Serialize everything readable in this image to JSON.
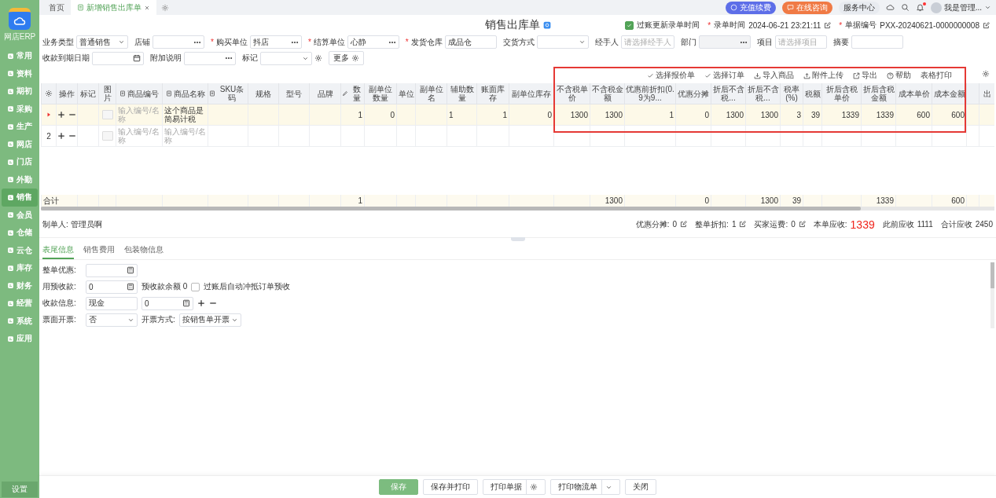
{
  "sidebar": {
    "logo_caption": "网店ERP",
    "items": [
      {
        "label": "常用",
        "selected": false
      },
      {
        "label": "资料",
        "selected": false
      },
      {
        "label": "期初",
        "selected": false
      },
      {
        "label": "采购",
        "selected": false
      },
      {
        "label": "生产",
        "selected": false
      },
      {
        "label": "网店",
        "selected": false
      },
      {
        "label": "门店",
        "selected": false
      },
      {
        "label": "外勤",
        "selected": false
      },
      {
        "label": "销售",
        "selected": true
      },
      {
        "label": "会员",
        "selected": false
      },
      {
        "label": "仓储",
        "selected": false
      },
      {
        "label": "云仓",
        "selected": false
      },
      {
        "label": "库存",
        "selected": false
      },
      {
        "label": "财务",
        "selected": false
      },
      {
        "label": "经营",
        "selected": false
      },
      {
        "label": "系统",
        "selected": false
      },
      {
        "label": "应用",
        "selected": false
      }
    ],
    "settings": "设置"
  },
  "tabs": [
    {
      "label": "首页",
      "selected": false,
      "closable": false
    },
    {
      "label": "新增销售出库单",
      "selected": true,
      "closable": true
    }
  ],
  "top_actions": [
    {
      "label": "充值续费",
      "kind": "recharge"
    },
    {
      "label": "在线咨询",
      "kind": "consult"
    },
    {
      "label": "服务中心",
      "kind": "plain"
    }
  ],
  "user": {
    "name": "我是管理..."
  },
  "notifications": {
    "unread": true
  },
  "title": "销售出库单",
  "meta": {
    "post_update": {
      "label": "过账更新录单时间",
      "checked": true
    },
    "fields": [
      {
        "required_mark": "*",
        "label": "录单时间",
        "value": "2024-06-21 23:21:11"
      },
      {
        "required_mark": "*",
        "label": "单据编号",
        "value": "PXX-20240621-0000000008"
      }
    ]
  },
  "filters": [
    {
      "label": "业务类型",
      "kind": "select",
      "value": "普通销售"
    },
    {
      "label": "店铺",
      "kind": "picker"
    },
    {
      "required_mark": "*",
      "label": "购买单位",
      "kind": "picker",
      "value": "抖店"
    },
    {
      "required_mark": "*",
      "label": "结算单位",
      "kind": "picker",
      "value": "心静"
    },
    {
      "required_mark": "*",
      "label": "发货仓库",
      "kind": "text",
      "value": "成品仓"
    },
    {
      "label": "交货方式",
      "kind": "select"
    },
    {
      "label": "经手人",
      "kind": "text",
      "placeholder": "请选择经手人"
    },
    {
      "label": "部门",
      "kind": "picker",
      "disabled": true
    },
    {
      "label": "项目",
      "kind": "text",
      "placeholder": "请选择项目"
    },
    {
      "label": "摘要",
      "kind": "text"
    },
    {
      "label": "收款到期日期",
      "kind": "date"
    },
    {
      "label": "附加说明",
      "kind": "picker"
    },
    {
      "label": "标记",
      "kind": "select",
      "settings": true
    }
  ],
  "more_button": "更多",
  "toolbar": [
    {
      "label": "选择报价单",
      "kind": "check"
    },
    {
      "label": "选择订单",
      "kind": "check"
    },
    {
      "label": "导入商品",
      "kind": "import"
    },
    {
      "label": "附件上传",
      "kind": "upload"
    },
    {
      "label": "导出",
      "kind": "export"
    },
    {
      "label": "帮助",
      "kind": "help"
    },
    {
      "label": "表格打印",
      "kind": "plain"
    }
  ],
  "table": {
    "columns": [
      {
        "kind": "settings"
      },
      {
        "label": "操作",
        "kind": "plain"
      },
      {
        "label": "标记",
        "kind": "plain"
      },
      {
        "label": "图片",
        "kind": "plain"
      },
      {
        "label": "商品编号",
        "kind": "picker"
      },
      {
        "label": "商品名称",
        "kind": "picker"
      },
      {
        "label": "SKU条码",
        "kind": "picker"
      },
      {
        "label": "规格",
        "kind": "plain"
      },
      {
        "label": "型号",
        "kind": "plain"
      },
      {
        "label": "品牌",
        "kind": "plain"
      },
      {
        "label": "数量",
        "kind": "editable"
      },
      {
        "label": "副单位数量",
        "kind": "plain"
      },
      {
        "label": "单位",
        "kind": "plain"
      },
      {
        "label": "副单位名",
        "kind": "plain"
      },
      {
        "label": "辅助数量",
        "kind": "plain"
      },
      {
        "label": "账面库存",
        "kind": "plain"
      },
      {
        "label": "副单位库存",
        "kind": "plain"
      },
      {
        "label": "不含税单价",
        "kind": "plain"
      },
      {
        "label": "不含税金额",
        "kind": "plain"
      },
      {
        "label": "优惠前折扣(0.9为9...",
        "kind": "plain"
      },
      {
        "label": "优惠分摊",
        "kind": "plain"
      },
      {
        "label": "折后不含税...",
        "kind": "plain"
      },
      {
        "label": "折后不含税...",
        "kind": "plain"
      },
      {
        "label": "税率(%)",
        "kind": "plain"
      },
      {
        "label": "税额",
        "kind": "plain"
      },
      {
        "label": "折后含税单价",
        "kind": "plain"
      },
      {
        "label": "折后含税金额",
        "kind": "plain"
      },
      {
        "label": "成本单价",
        "kind": "plain"
      },
      {
        "label": "成本金额",
        "kind": "plain"
      },
      {
        "kind": "plain"
      },
      {
        "label": "出",
        "kind": "plain"
      }
    ],
    "rows": [
      {
        "selected": true,
        "cells": [
          null,
          null,
          null,
          null,
          {
            "placeholder": "输入编号/名称"
          },
          {
            "text": "这个商品是简易计税"
          },
          null,
          null,
          null,
          null,
          {
            "text": "1"
          },
          {
            "text": "0"
          },
          null,
          null,
          {
            "text": "1"
          },
          {
            "text": "1"
          },
          {
            "text": "0"
          },
          {
            "text": "1300"
          },
          {
            "text": "1300"
          },
          {
            "text": "1"
          },
          {
            "text": "0"
          },
          {
            "text": "1300"
          },
          {
            "text": "1300"
          },
          {
            "text": "3"
          },
          {
            "text": "39"
          },
          {
            "text": "1339"
          },
          {
            "text": "1339"
          },
          {
            "text": "600"
          },
          {
            "text": "600"
          },
          null,
          null
        ]
      },
      {
        "selected": false,
        "row_label": "2",
        "cells": [
          null,
          null,
          null,
          null,
          {
            "placeholder": "输入编号/名称"
          },
          {
            "placeholder": "输入编号/名称"
          },
          null,
          null,
          null,
          null,
          null,
          null,
          null,
          null,
          null,
          null,
          null,
          null,
          null,
          null,
          null,
          null,
          null,
          null,
          null,
          null,
          null,
          null,
          null,
          null,
          null
        ]
      }
    ],
    "total": {
      "label": "合计",
      "cells": [
        null,
        null,
        null,
        null,
        null,
        null,
        null,
        null,
        null,
        null,
        "1",
        null,
        null,
        null,
        null,
        null,
        null,
        null,
        "1300",
        null,
        "0",
        null,
        "1300",
        "39",
        null,
        null,
        "1339",
        null,
        "600",
        null,
        null
      ]
    }
  },
  "creator": "制单人: 管理员啊",
  "summary": [
    {
      "label": "优惠分摊:",
      "value": "0",
      "kind": "editable"
    },
    {
      "label": "整单折扣:",
      "value": "1",
      "kind": "editable"
    },
    {
      "label": "买家运费:",
      "value": "0",
      "kind": "editable"
    },
    {
      "label": "本单应收:",
      "value": "1339",
      "kind": "emphasis"
    },
    {
      "label": "此前应收",
      "value": "1111",
      "kind": "plain"
    },
    {
      "label": "合计应收",
      "value": "2450",
      "kind": "plain"
    }
  ],
  "detail_tabs": [
    {
      "label": "表尾信息",
      "selected": true
    },
    {
      "label": "销售费用",
      "selected": false
    },
    {
      "label": "包装物信息",
      "selected": false
    }
  ],
  "form": [
    {
      "label": "整单优惠:",
      "items": [
        {
          "kind": "calc"
        }
      ]
    },
    {
      "label": "用预收款:",
      "items": [
        {
          "kind": "calc",
          "value": "0"
        },
        {
          "kind": "text",
          "text": "预收款余额 0"
        },
        {
          "kind": "checkbox",
          "text": "过账后自动冲抵订单预收",
          "checked": false
        }
      ]
    },
    {
      "label": "收款信息:",
      "items": [
        {
          "kind": "input",
          "value": "现金"
        },
        {
          "kind": "calc",
          "value": "0"
        },
        {
          "kind": "add"
        },
        {
          "kind": "remove"
        }
      ]
    },
    {
      "label": "票面开票:",
      "items": [
        {
          "kind": "select",
          "value": "否"
        },
        {
          "kind": "text",
          "text": "开票方式:"
        },
        {
          "kind": "select",
          "value": "按销售单开票"
        }
      ]
    }
  ],
  "footer_buttons": [
    {
      "label": "保存",
      "kind": "primary"
    },
    {
      "label": "保存并打印",
      "kind": "plain"
    },
    {
      "label": "打印单据",
      "kind": "settings"
    },
    {
      "label": "打印物流单",
      "kind": "dropdown"
    },
    {
      "label": "关闭",
      "kind": "plain"
    }
  ]
}
